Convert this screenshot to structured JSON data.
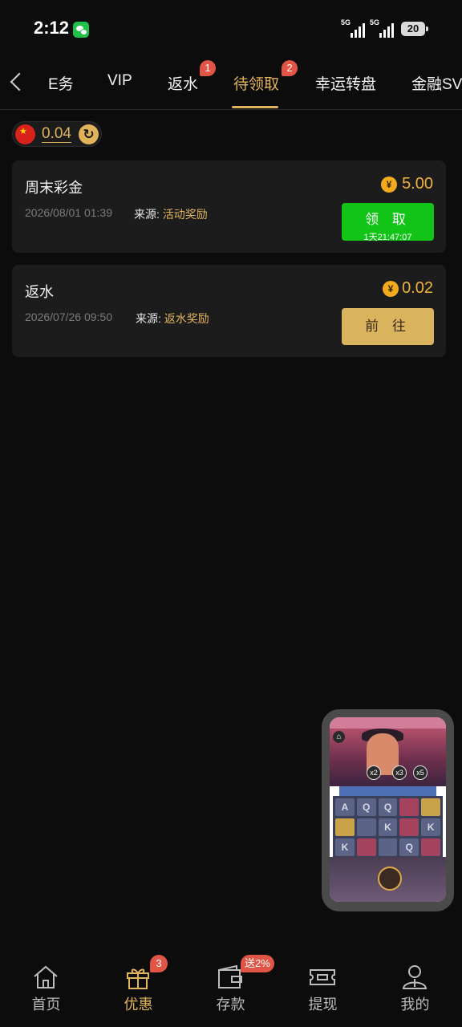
{
  "status_bar": {
    "time": "2:12",
    "signal_1": "5G",
    "signal_2": "5G",
    "battery": "20"
  },
  "tabs": {
    "items": [
      {
        "label": "任务"
      },
      {
        "label": "VIP"
      },
      {
        "label": "返水",
        "badge": "1"
      },
      {
        "label": "待领取",
        "badge": "2",
        "active": true
      },
      {
        "label": "幸运转盘"
      },
      {
        "label": "金融SVIP"
      }
    ],
    "visible_first_label": "E务",
    "active_color": "#e1b45c"
  },
  "balance": {
    "value": "0.04",
    "flag_icon": "china-flag-icon",
    "refresh_icon": "refresh-icon"
  },
  "rewards": [
    {
      "title": "周末彩金",
      "date": "2026/08/01 01:39",
      "source_label": "来源:",
      "source_value": "活动奖励",
      "amount": "5.00",
      "currency_symbol": "¥",
      "button_label": "领 取",
      "button_countdown": "1天21:47:07",
      "button_color": "#12c418"
    },
    {
      "title": "返水",
      "date": "2026/07/26 09:50",
      "source_label": "来源:",
      "source_value": "返水奖励",
      "amount": "0.02",
      "currency_symbol": "¥",
      "button_label": "前 往",
      "button_color": "#d9b35e"
    }
  ],
  "floating_game": {
    "multipliers": [
      "x2",
      "x3",
      "x5"
    ],
    "symbols": [
      "A",
      "Q",
      "Q",
      "",
      "",
      " ",
      "",
      "K",
      "",
      "K",
      "K",
      "",
      "",
      "Q",
      ""
    ]
  },
  "bottom_nav": {
    "items": [
      {
        "label": "首页",
        "icon": "home-icon"
      },
      {
        "label": "优惠",
        "icon": "gift-icon",
        "badge": "3",
        "active": true
      },
      {
        "label": "存款",
        "icon": "wallet-icon",
        "badge": "送2%"
      },
      {
        "label": "提现",
        "icon": "ticket-icon"
      },
      {
        "label": "我的",
        "icon": "user-icon"
      }
    ]
  }
}
